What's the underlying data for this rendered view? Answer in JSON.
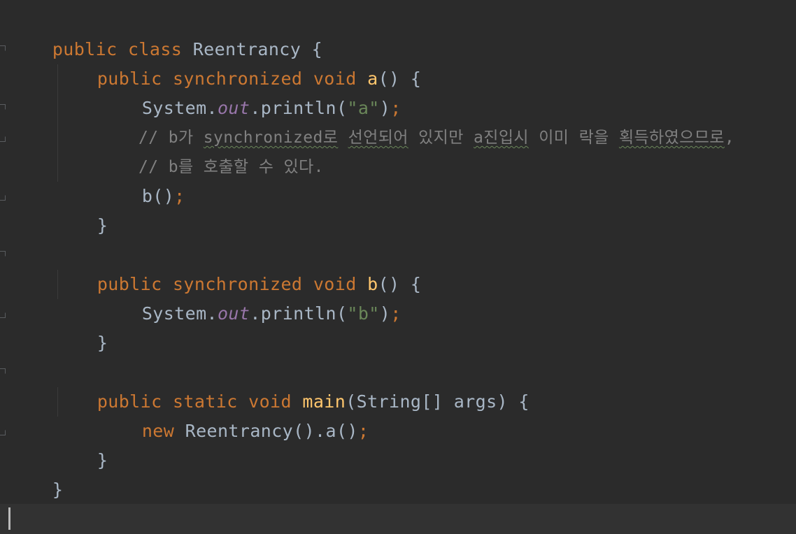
{
  "editor": {
    "lines": {
      "l1": {
        "kw1": "public class ",
        "name": "Reentrancy",
        "rest": " {"
      },
      "l2": {
        "kw1": "public synchronized void ",
        "fn": "a",
        "rest": "() {"
      },
      "l3": {
        "cls": "System.",
        "field": "out",
        "call": ".println(",
        "str": "\"a\"",
        "close": ")",
        "semi": ";"
      },
      "l4": {
        "c1": "// b가 ",
        "c2": "synchronized로",
        "c3": " ",
        "c4": "선언되어",
        "c5": " 있지만 ",
        "c6": "a진입시",
        "c7": " 이미 락을 ",
        "c8": "획득하였으므로",
        "c9": ","
      },
      "l5": {
        "comment": "// b를 호출할 수 있다."
      },
      "l6": {
        "call": "b()",
        "semi": ";"
      },
      "l7": {
        "brace": "}"
      },
      "l9": {
        "kw1": "public synchronized void ",
        "fn": "b",
        "rest": "() {"
      },
      "l10": {
        "cls": "System.",
        "field": "out",
        "call": ".println(",
        "str": "\"b\"",
        "close": ")",
        "semi": ";"
      },
      "l11": {
        "brace": "}"
      },
      "l13": {
        "kw1": "public static void ",
        "fn": "main",
        "rest": "(String[] args) {"
      },
      "l14": {
        "kw1": "new ",
        "call": "Reentrancy().a()",
        "semi": ";"
      },
      "l15": {
        "brace": "}"
      },
      "l16": {
        "brace": "}"
      }
    }
  }
}
